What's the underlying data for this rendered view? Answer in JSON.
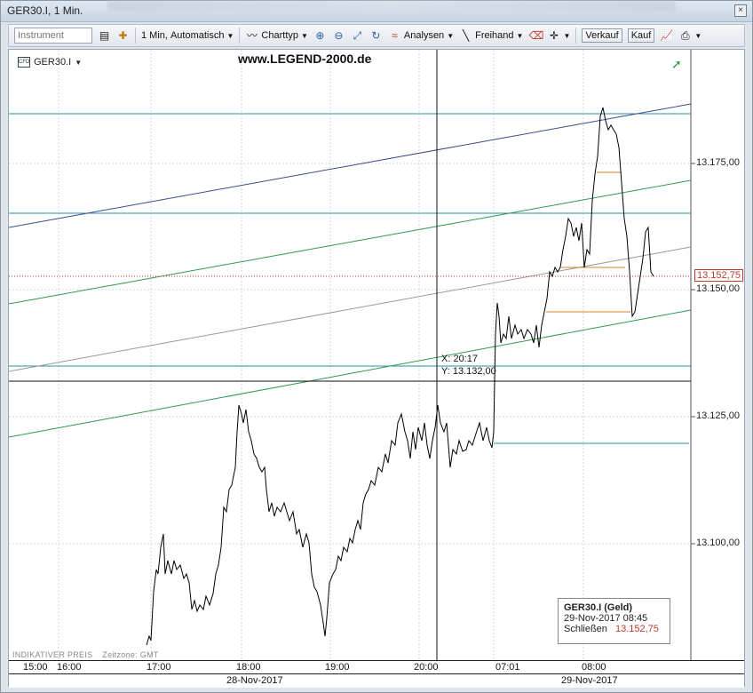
{
  "window": {
    "title": "GER30.I, 1 Min.",
    "close_icon": "close-icon",
    "resize_icon": "resize-icon"
  },
  "toolbar": {
    "instrument_placeholder": "Instrument",
    "interval_label": "1 Min,",
    "mode_label": "Automatisch",
    "charttyp_label": "Charttyp",
    "analysen_label": "Analysen",
    "freihand_label": "Freihand",
    "verkauf_label": "Verkauf",
    "kauf_label": "Kauf"
  },
  "chart": {
    "symbol": "GER30.I",
    "watermark": "www.LEGEND-2000.de",
    "current_price": "13.152,75",
    "crosshair_x": "X: 20:17",
    "crosshair_y": "Y: 13.132,00",
    "indikativ": "INDIKATIVER PREIS",
    "zeitzone": "Zeitzone: GMT",
    "infobox": {
      "title": "GER30.I (Geld)",
      "datetime": "29-Nov-2017 08:45",
      "close_label": "Schließen",
      "close_value": "13.152,75"
    },
    "colors": {
      "price_line": "#000000",
      "cyan_lines": "#2a8fa8",
      "navy_line": "#3b4a8a",
      "green_line": "#2e9a4a",
      "gray_line": "#9a9a9a",
      "orange_lines": "#d9822b",
      "current_price": "#c0392b"
    }
  },
  "chart_data": {
    "type": "line",
    "y_tick_labels": [
      "13.175,00",
      "13.150,00",
      "13.125,00",
      "13.100,00"
    ],
    "x_tick_labels": [
      "15:00",
      "16:00",
      "17:00",
      "18:00",
      "19:00",
      "20:00",
      "07:01",
      "08:00"
    ],
    "date_labels": [
      "28-Nov-2017",
      "29-Nov-2017"
    ],
    "ylim": [
      13080,
      13195
    ],
    "horizontal_levels": [
      13184.5,
      13165,
      13135
    ],
    "series": [
      {
        "values": [
          13080,
          13082,
          13087,
          13100,
          13102,
          13098,
          13092,
          13096,
          13088,
          13090,
          13097,
          13111,
          13126,
          13120,
          13110,
          13104,
          13106,
          13094,
          13082,
          13098,
          13101,
          13099,
          13108,
          13112,
          13117,
          13125,
          13120,
          13123,
          13118,
          13126,
          13121,
          13119,
          13138,
          13145,
          13140,
          13150,
          13165,
          13155,
          13170,
          13186,
          13158,
          13145,
          13162,
          13152.75
        ]
      }
    ]
  }
}
